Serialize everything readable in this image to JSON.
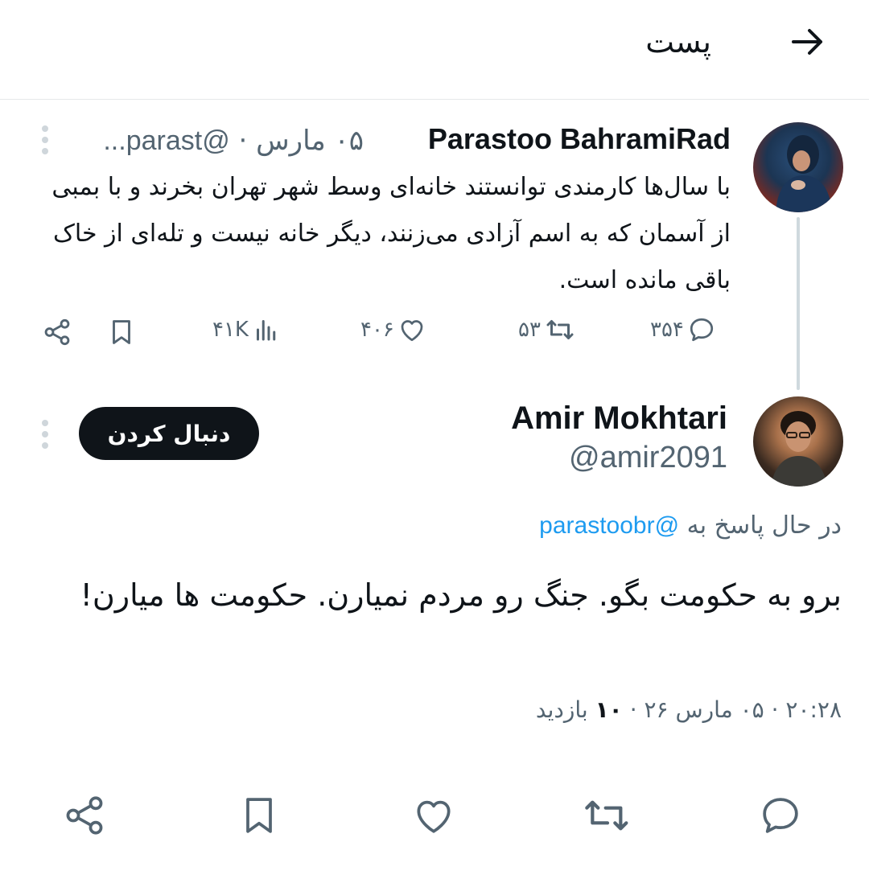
{
  "header": {
    "title": "پست",
    "back_icon": "arrow-right-icon"
  },
  "parent_tweet": {
    "name": "Parastoo BahramiRad",
    "handle": "@parast...",
    "date": "۰۵ مارس",
    "separator": "·",
    "text": "با سال‌ها کارمندی توانستند خانه‌ای وسط شهر تهران بخرند و با بمبی از آسمان که به اسم آزادی می‌زنند، دیگر خانه نیست و تله‌ای از خاک باقی مانده است.",
    "replies": "۳۵۴",
    "reposts": "۵۳",
    "likes": "۴۰۶",
    "views": "۴۱K"
  },
  "reply_tweet": {
    "name": "Amir Mokhtari",
    "handle": "@amir2091",
    "follow_label": "دنبال کردن",
    "replying_prefix": "در حال پاسخ به",
    "replying_handle": "@parastoobr",
    "text": "برو به حکومت بگو. جنگ رو مردم نمیارن. حکومت ها میارن!",
    "time": "۲۰:۲۸",
    "date": "۰۵ مارس ۲۶",
    "separator": "·",
    "views_count": "۱۰",
    "views_label": "بازدید"
  },
  "colors": {
    "text": "#0f1419",
    "muted": "#536471",
    "link": "#1d9bf0",
    "divider": "#e6e8ea"
  }
}
